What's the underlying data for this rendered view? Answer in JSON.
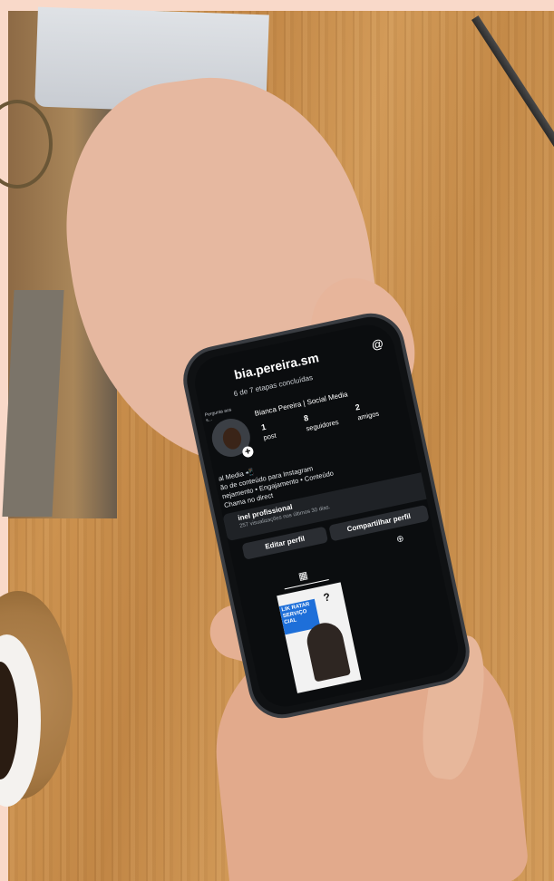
{
  "scene": {
    "background_frame_color": "#f9d9c9",
    "desk_color": "#c98f4e"
  },
  "profile": {
    "username": "bia.pereira.sm",
    "steps_progress": "6 de 7 etapas concluídas",
    "full_name": "Bianca Pereira | Social Media",
    "note_bubble": "Pergunta aos s...",
    "stats": [
      {
        "count": "1",
        "label": "post"
      },
      {
        "count": "8",
        "label": "seguidores"
      },
      {
        "count": "2",
        "label": "amigos"
      }
    ],
    "bio_lines": [
      "al Media 📲",
      "ão de conteúdo para Instagram",
      "nejamento • Engajamento • Conteúdo",
      "Chama no direct"
    ],
    "dashboard_title": "inel profissional",
    "dashboard_subtitle": "257 visualizações nos últimos 30 dias.",
    "edit_button": "Editar perfil",
    "share_button": "Compartilhar perfil",
    "post_text": "LIK RATAR SERVIÇO CIAL"
  },
  "icons": [
    "threads-icon",
    "chevron-down-icon",
    "plus-icon",
    "person-add-icon",
    "grid-icon"
  ]
}
